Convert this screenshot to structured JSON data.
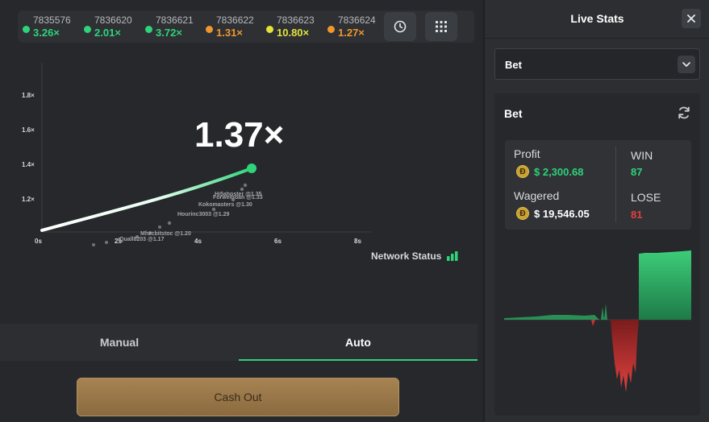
{
  "history": [
    {
      "id": "7835576",
      "multiplier": "3.26×",
      "color": "#2ed37a"
    },
    {
      "id": "7836620",
      "multiplier": "2.01×",
      "color": "#2ed37a"
    },
    {
      "id": "7836621",
      "multiplier": "3.72×",
      "color": "#2ed37a"
    },
    {
      "id": "7836622",
      "multiplier": "1.31×",
      "color": "#f0962e"
    },
    {
      "id": "7836623",
      "multiplier": "10.80×",
      "color": "#e3e23a"
    },
    {
      "id": "7836624",
      "multiplier": "1.27×",
      "color": "#f0962e"
    }
  ],
  "history_icons": {
    "history": "clock-icon",
    "grid": "grid-icon"
  },
  "game": {
    "current_multiplier": "1.37×",
    "y_ticks": [
      "1.8×",
      "1.6×",
      "1.4×",
      "1.2×"
    ],
    "x_ticks": [
      "0s",
      "2s",
      "4s",
      "6s",
      "8s"
    ],
    "players": [
      "Hi5ahoster @1.35",
      "Forweinoan @1.33",
      "Kokomasters @1.30",
      "Hourinc3003 @1.29",
      "Mhzcbitstoc @1.20",
      "Quall8203 @1.17"
    ],
    "network_status": "Network Status"
  },
  "tabs": {
    "manual": "Manual",
    "auto": "Auto"
  },
  "cashout_label": "Cash Out",
  "panel": {
    "title": "Live Stats",
    "select_value": "Bet",
    "card_title": "Bet",
    "profit_label": "Profit",
    "profit_value": "$ 2,300.68",
    "wagered_label": "Wagered",
    "wagered_value": "$ 19,546.05",
    "win_label": "WIN",
    "win_value": "87",
    "lose_label": "LOSE",
    "lose_value": "81",
    "coin_symbol": "Ð"
  },
  "colors": {
    "accent_green": "#2ed37a",
    "lose_red": "#e0413f",
    "cashout": "#a78352"
  }
}
